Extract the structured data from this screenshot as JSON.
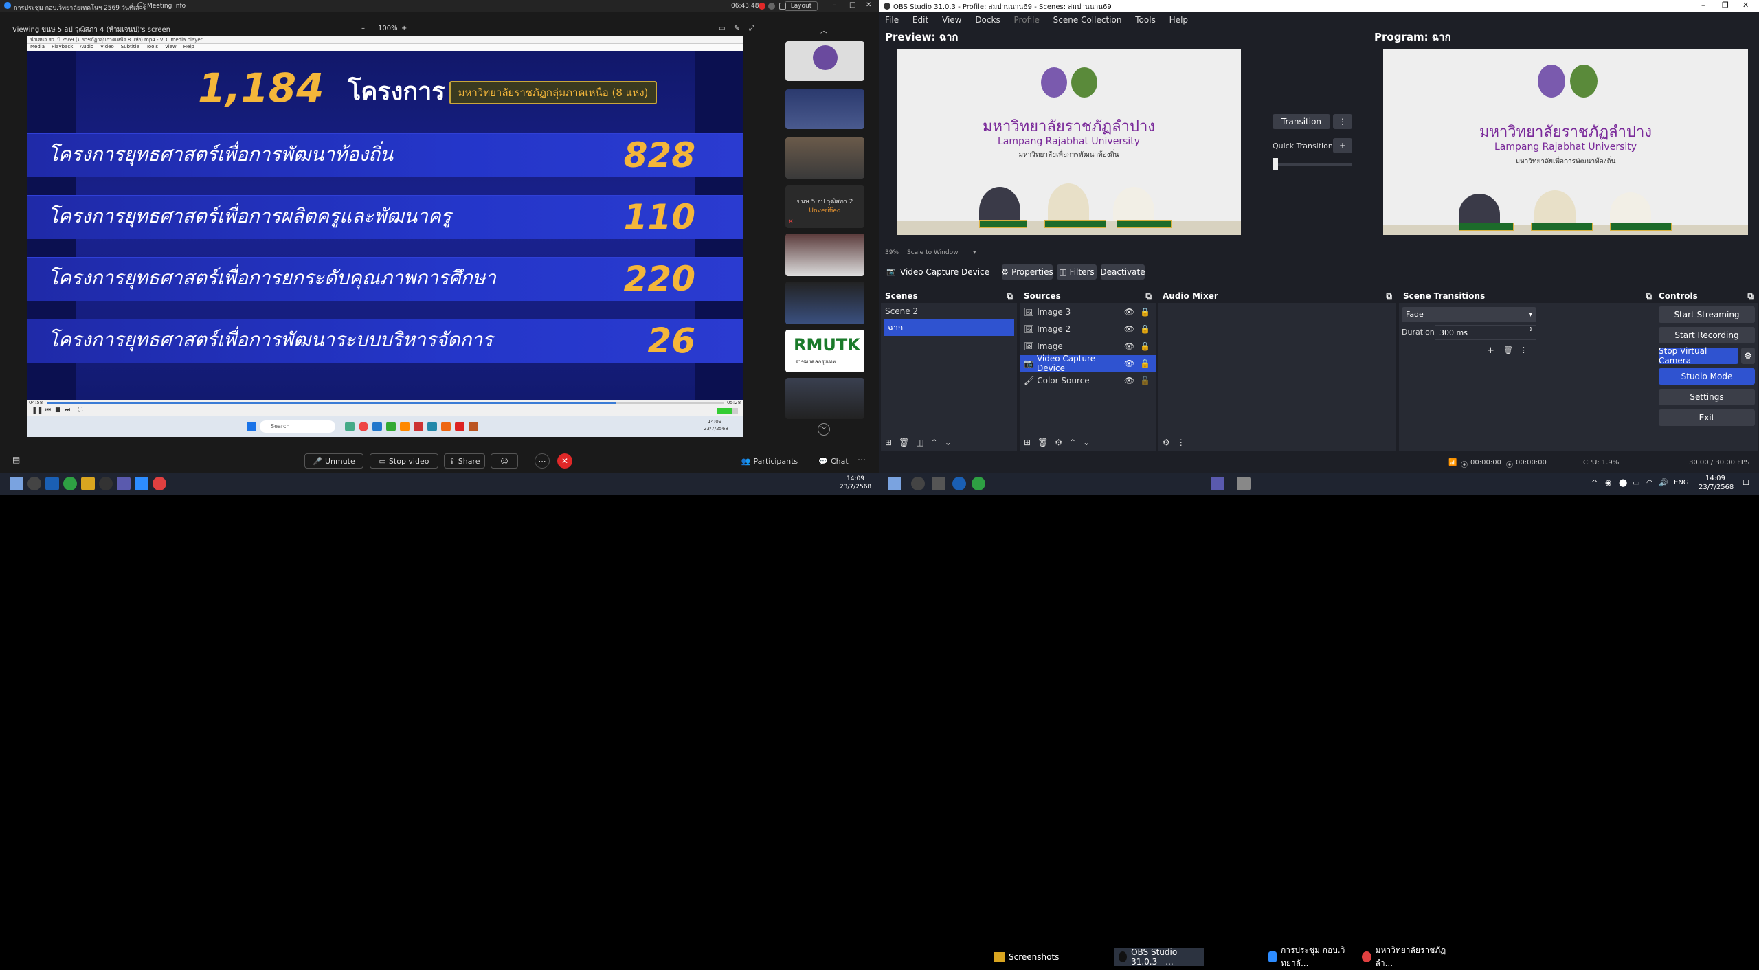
{
  "zoom": {
    "title_app": "การประชุม กอบ.วิทยาลัยเทคโนฯ 2569 วันที่เสาร์",
    "title_meeting_info": "Meeting Info",
    "time": "06:43:48",
    "layout_label": "Layout",
    "viewing_label": "Viewing ขนษ 5 อป วุฒิสภา 4 (ห้ามเจนป)'s screen",
    "zoom_level": "100%",
    "vlc_title": "นำเสนอ สว. ปี 2569 (ม.ราชภัฏกลุ่มภาคเหนือ 8 แห่ง).mp4 - VLC media player",
    "vlc_menu": [
      "Media",
      "Playback",
      "Audio",
      "Video",
      "Subtitle",
      "Tools",
      "View",
      "Help"
    ],
    "slide": {
      "headline_number": "1,184",
      "headline_word": "โครงการ",
      "badge": "มหาวิทยาลัยราชภัฏกลุ่มภาคเหนือ (8 แห่ง)",
      "rows": [
        {
          "label": "โครงการยุทธศาสตร์เพื่อการพัฒนาท้องถิ่น",
          "value": "828"
        },
        {
          "label": "โครงการยุทธศาสตร์เพื่อการผลิตครูและพัฒนาครู",
          "value": "110"
        },
        {
          "label": "โครงการยุทธศาสตร์เพื่อการยกระดับคุณภาพการศึกษา",
          "value": "220"
        },
        {
          "label": "โครงการยุทธศาสตร์เพื่อการพัฒนาระบบบริหารจัดการ",
          "value": "26"
        }
      ]
    },
    "video_time_left": "04:58",
    "video_time_right": "05:28",
    "participant_name": "ขนษ 5 อป วุฒิสภา 2",
    "participant_status": "Unverified",
    "rmutk_text": "RMUTK",
    "rmutk_sub": "ราชมงคลกรุงเทพ",
    "inner_search": "Search",
    "inner_clock": "14:09",
    "inner_date": "23/7/2568",
    "controls": {
      "unmute": "Unmute",
      "stop_video": "Stop video",
      "share": "Share",
      "participants": "Participants",
      "chat": "Chat"
    }
  },
  "obs": {
    "title": "OBS Studio 31.0.3 - Profile: สมปานนาน69 - Scenes: สมปานนาน69",
    "menu": [
      "File",
      "Edit",
      "View",
      "Docks",
      "Profile",
      "Scene Collection",
      "Tools",
      "Help"
    ],
    "preview_label": "Preview: ฉาก",
    "program_label": "Program: ฉาก",
    "transition_label": "Transition",
    "quick_transitions": "Quick Transitions",
    "zoom_pct": "39%",
    "scale_label": "Scale to Window",
    "university_th": "มหาวิทยาลัยราชภัฏลำปาง",
    "university_en": "Lampang Rajabhat University",
    "university_slogan": "มหาวิทยาลัยเพื่อการพัฒนาท้องถิ่น",
    "source_bar": {
      "name": "Video Capture Device",
      "properties": "Properties",
      "filters": "Filters",
      "deactivate": "Deactivate"
    },
    "scenes": {
      "title": "Scenes",
      "items": [
        "Scene 2",
        "ฉาก"
      ],
      "selected": 1
    },
    "sources": {
      "title": "Sources",
      "items": [
        "Image 3",
        "Image 2",
        "Image",
        "Video Capture Device",
        "Color Source"
      ],
      "selected": 3
    },
    "audio_mixer": {
      "title": "Audio Mixer"
    },
    "scene_transitions": {
      "title": "Scene Transitions",
      "type": "Fade",
      "duration_label": "Duration",
      "duration_value": "300 ms"
    },
    "controls": {
      "title": "Controls",
      "buttons": [
        "Start Streaming",
        "Start Recording",
        "Stop Virtual Camera",
        "Studio Mode",
        "Settings",
        "Exit"
      ]
    },
    "status": {
      "stream_time": "00:00:00",
      "rec_time": "00:00:00",
      "cpu": "CPU: 1.9%",
      "fps": "30.00 / 30.00 FPS"
    }
  },
  "taskbar": {
    "items": [
      "Screenshots",
      "OBS Studio 31.0.3 - ...",
      "การประชุม กอบ.วิทยาลั...",
      "มหาวิทยาลัยราชภัฏลำ..."
    ],
    "lang": "ENG",
    "clock": "14:09",
    "date": "23/7/2568"
  },
  "colors": {
    "accent": "#2f53d0",
    "zoom_red": "#e02828",
    "obs_bg": "#1d1f26",
    "slide_gold": "#f4b63a"
  }
}
